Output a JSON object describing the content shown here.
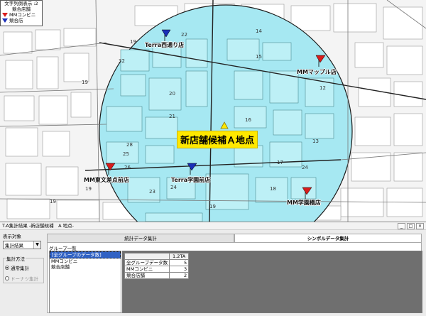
{
  "map": {
    "legend": {
      "title": "文字列倒表示 :2",
      "subtitle": "競合店舗",
      "items": [
        {
          "label": "MMコンビニ",
          "color": "#d81c1c"
        },
        {
          "label": "競合店",
          "color": "#1a2fb8"
        }
      ]
    },
    "candidate": {
      "label": "新店舗候補Ａ地点"
    },
    "stores": [
      {
        "name": "Terra西通り店",
        "type": "competitor"
      },
      {
        "name": "MMマップル店",
        "type": "mm"
      },
      {
        "name": "MM東文差点前店",
        "type": "mm"
      },
      {
        "name": "Terra学園前店",
        "type": "competitor"
      },
      {
        "name": "MM学園橋店",
        "type": "mm"
      }
    ],
    "block_numbers": [
      "19",
      "22",
      "19",
      "21",
      "20",
      "19",
      "14",
      "15",
      "16",
      "25",
      "32",
      "26",
      "28",
      "24",
      "23",
      "18",
      "17",
      "19",
      "13",
      "12",
      "24",
      "19"
    ],
    "colors": {
      "circle_fill": "#a6e8f2",
      "circle_stroke": "#1a1a1a",
      "candidate": "#ffe800"
    }
  },
  "window": {
    "title": "T.A集計結果 -新店舗候補　A 地点-",
    "controls": [
      "_",
      "□",
      "×"
    ]
  },
  "left": {
    "display_label": "表示対象",
    "display_value": "集計結果",
    "method_label": "集計方法",
    "options": [
      {
        "label": "通常集計",
        "selected": true,
        "disabled": false
      },
      {
        "label": "ドーナツ集計",
        "selected": false,
        "disabled": true
      }
    ]
  },
  "tabs": [
    {
      "label": "統計データ集計",
      "active": false
    },
    {
      "label": "シンボルデータ集計",
      "active": true
    }
  ],
  "group_list": {
    "label": "グループ一覧",
    "items": [
      "[全グループのデータ数]",
      "MMコンビニ",
      "競合店舗"
    ],
    "selected_index": 0
  },
  "table": {
    "header": [
      "",
      "1.2TA"
    ],
    "rows": [
      {
        "label": "全グループデータ数",
        "value": "5"
      },
      {
        "label": "MMコンビニ",
        "value": "3"
      },
      {
        "label": "競合店舗",
        "value": "2"
      }
    ]
  }
}
